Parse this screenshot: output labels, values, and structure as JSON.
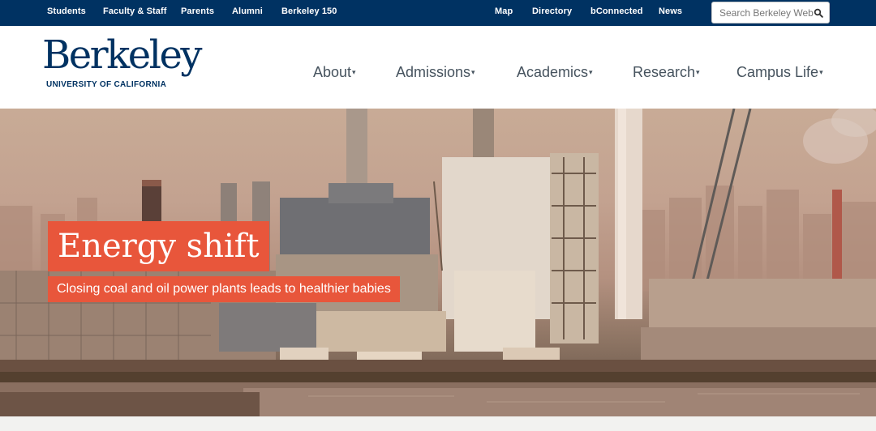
{
  "utility_nav": {
    "left_links": [
      "Students",
      "Faculty & Staff",
      "Parents",
      "Alumni",
      "Berkeley 150"
    ],
    "right_links": [
      "Map",
      "Directory",
      "bConnected",
      "News"
    ],
    "search_placeholder": "Search Berkeley Web",
    "search_icon": "magnifier-icon"
  },
  "brand": {
    "wordmark": "Berkeley",
    "subtitle": "UNIVERSITY OF CALIFORNIA"
  },
  "main_nav": [
    {
      "label": "About"
    },
    {
      "label": "Admissions"
    },
    {
      "label": "Academics"
    },
    {
      "label": "Research"
    },
    {
      "label": "Campus Life"
    }
  ],
  "hero": {
    "headline": "Energy shift",
    "subhead": "Closing coal and oil power plants leads to healthier babies"
  },
  "colors": {
    "berkeley_blue": "#003262",
    "accent_orange": "#e8563b",
    "nav_text": "#46535e"
  }
}
